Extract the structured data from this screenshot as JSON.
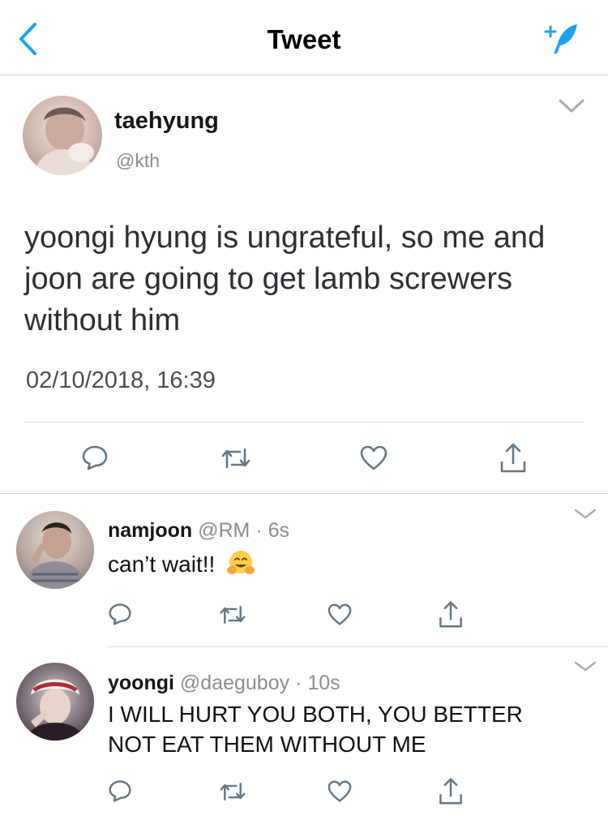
{
  "header": {
    "title": "Tweet"
  },
  "main_tweet": {
    "name": "taehyung",
    "handle": "@kth",
    "text": "yoongi hyung is ungrateful, so me and joon are going to get lamb screwers without him",
    "timestamp": "02/10/2018, 16:39"
  },
  "replies": [
    {
      "name": "namjoon",
      "handle": "@RM",
      "dot": "·",
      "time": "6s",
      "text": "can’t wait!!",
      "emoji": "hugging-face"
    },
    {
      "name": "yoongi",
      "handle": "@daeguboy",
      "dot": "·",
      "time": "10s",
      "text": "I WILL HURT YOU BOTH, YOU BETTER NOT EAT THEM WITHOUT ME"
    }
  ],
  "colors": {
    "accent": "#1da1f2",
    "icon_gray": "#657786",
    "divider": "#dcdcdc"
  }
}
